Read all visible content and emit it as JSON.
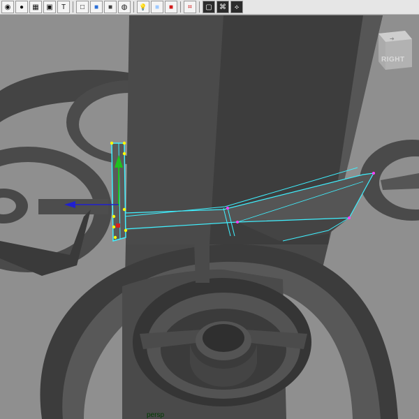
{
  "toolbar": {
    "buttons": [
      {
        "name": "select-camera-icon",
        "glyph": "◉"
      },
      {
        "name": "light-sphere-icon",
        "glyph": "●"
      },
      {
        "name": "grid-icon",
        "glyph": "▦"
      },
      {
        "name": "image-plane-icon",
        "glyph": "▣"
      },
      {
        "name": "text-icon",
        "glyph": "T"
      },
      {
        "name": "wireframe-cube-icon",
        "glyph": "□"
      },
      {
        "name": "smooth-shade-cube-icon",
        "glyph": "■"
      },
      {
        "name": "wireframe-on-shaded-icon",
        "glyph": "■"
      },
      {
        "name": "xray-icon",
        "glyph": "◍"
      },
      {
        "name": "lighting-icon",
        "glyph": "💡"
      },
      {
        "name": "default-material-icon",
        "glyph": "■"
      },
      {
        "name": "texture-icon",
        "glyph": "■"
      },
      {
        "name": "isolate-select-icon",
        "glyph": "⌗"
      },
      {
        "name": "backface-cube-icon",
        "glyph": "▢"
      },
      {
        "name": "resolution-gate-icon",
        "glyph": "⌘"
      },
      {
        "name": "hierarchy-icon",
        "glyph": "⟡"
      }
    ]
  },
  "viewcube": {
    "face_label": "RIGHT"
  },
  "viewport": {
    "camera_label": "persp"
  },
  "colors": {
    "viewport_bg": "#8f8f8f",
    "mesh_dark": "#3e3e3e",
    "mesh_mid": "#555555",
    "selection_cyan": "#3ff0ff",
    "vertex_yellow": "#ffff00",
    "axis_green": "#1fc11f",
    "axis_blue": "#2020d0"
  }
}
